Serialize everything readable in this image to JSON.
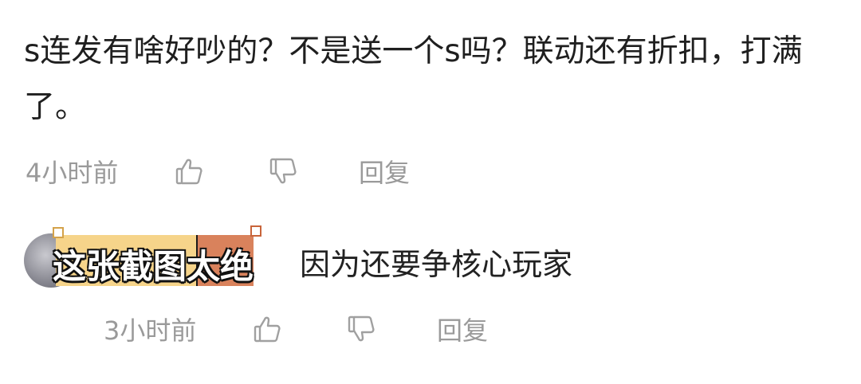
{
  "comment": {
    "text": "s连发有啥好吵的？不是送一个s吗？联动还有折扣，打满了。",
    "time": "4小时前",
    "reply_label": "回复",
    "like_icon": "thumbs-up-icon",
    "dislike_icon": "thumbs-down-icon"
  },
  "reply": {
    "avatar": "avatar",
    "sticker_text": "这张截图太绝",
    "text": "因为还要争核心玩家",
    "time": "3小时前",
    "reply_label": "回复",
    "like_icon": "thumbs-up-icon",
    "dislike_icon": "thumbs-down-icon"
  },
  "colors": {
    "meta_gray": "#9a9a9a",
    "sticker_yellow": "#f6d48a",
    "sticker_orange": "#d9825c"
  }
}
